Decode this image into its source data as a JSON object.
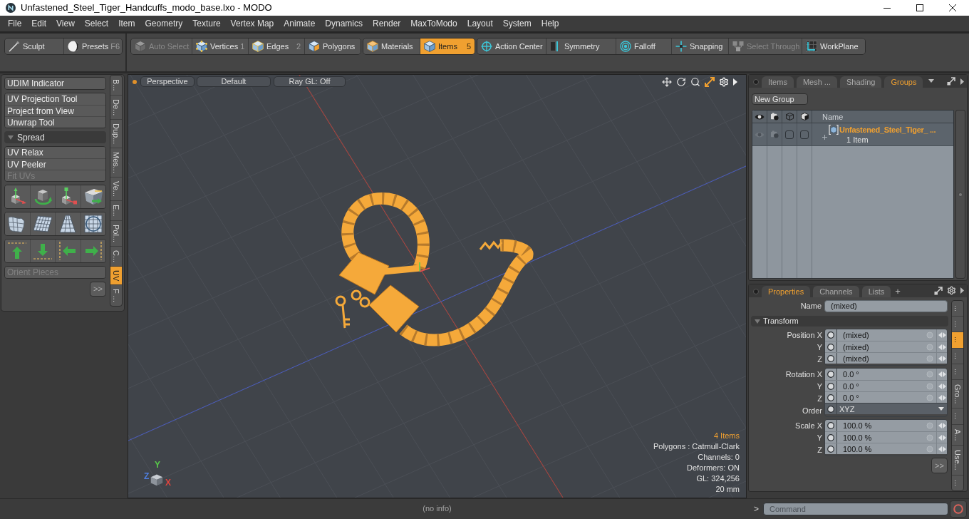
{
  "window": {
    "title": "Unfastened_Steel_Tiger_Handcuffs_modo_base.lxo - MODO"
  },
  "menu": [
    "File",
    "Edit",
    "View",
    "Select",
    "Item",
    "Geometry",
    "Texture",
    "Vertex Map",
    "Animate",
    "Dynamics",
    "Render",
    "MaxToModo",
    "Layout",
    "System",
    "Help"
  ],
  "toolbar": [
    {
      "tools": [
        {
          "label": "Sculpt",
          "selected": false,
          "disabled": false
        },
        {
          "label": "Presets",
          "shortcut": "F6",
          "selected": false,
          "disabled": false
        }
      ]
    },
    {
      "tools": [
        {
          "label": "Auto Select",
          "selected": false,
          "disabled": true
        },
        {
          "label": "Vertices",
          "shortcut": "1",
          "selected": false,
          "disabled": false
        },
        {
          "label": "Edges",
          "shortcut": "2",
          "selected": false,
          "disabled": false
        },
        {
          "label": "Polygons",
          "selected": false,
          "disabled": false
        }
      ]
    },
    {
      "tools": [
        {
          "label": "Materials",
          "selected": false,
          "disabled": false
        },
        {
          "label": "Items",
          "shortcut": "5",
          "selected": true,
          "disabled": false
        }
      ]
    },
    {
      "tools": [
        {
          "label": "Action Center",
          "selected": false,
          "disabled": false
        },
        {
          "label": "Symmetry",
          "selected": false,
          "disabled": false
        },
        {
          "label": "Falloff",
          "selected": false,
          "disabled": false
        },
        {
          "label": "Snapping",
          "selected": false,
          "disabled": false
        },
        {
          "label": "Select Through",
          "selected": false,
          "disabled": true
        },
        {
          "label": "WorkPlane",
          "selected": false,
          "disabled": false
        }
      ]
    }
  ],
  "tool_panel": {
    "groups": [
      {
        "kind": "buttons",
        "items": [
          {
            "label": "UDIM Indicator",
            "disabled": false
          }
        ]
      },
      {
        "kind": "buttons",
        "items": [
          {
            "label": "UV Projection Tool",
            "disabled": false
          },
          {
            "label": "Project from View",
            "disabled": false
          },
          {
            "label": "Unwrap Tool",
            "disabled": false
          }
        ]
      },
      {
        "kind": "section",
        "label": "Spread",
        "expanded": true
      },
      {
        "kind": "buttons",
        "items": [
          {
            "label": "UV Relax",
            "disabled": false
          },
          {
            "label": "UV Peeler",
            "disabled": false
          },
          {
            "label": "Fit UVs",
            "disabled": true
          }
        ]
      },
      {
        "kind": "icon_grid"
      },
      {
        "kind": "buttons",
        "items": [
          {
            "label": "Orient Pieces",
            "disabled": true
          }
        ]
      }
    ],
    "more_button": ">>",
    "side_tabs": [
      {
        "label": "B...",
        "selected": false
      },
      {
        "label": "De...",
        "selected": false
      },
      {
        "label": "Dup...",
        "selected": false
      },
      {
        "label": "Mes...",
        "selected": false
      },
      {
        "label": "Ve...",
        "selected": false
      },
      {
        "label": "E...",
        "selected": false
      },
      {
        "label": "Pol...",
        "selected": false
      },
      {
        "label": "C...",
        "selected": false
      },
      {
        "label": "UV",
        "selected": true
      },
      {
        "label": "F ...",
        "selected": false
      }
    ]
  },
  "viewport": {
    "view_buttons": [
      "Perspective",
      "Default",
      "Ray GL: Off"
    ],
    "info": [
      {
        "text": "4 Items",
        "highlight": true
      },
      {
        "text": "Polygons : Catmull-Clark",
        "highlight": false
      },
      {
        "text": "Channels: 0",
        "highlight": false
      },
      {
        "text": "Deformers: ON",
        "highlight": false
      },
      {
        "text": "GL: 324,256",
        "highlight": false
      },
      {
        "text": "20 mm",
        "highlight": false
      }
    ],
    "axes": [
      {
        "label": "Y",
        "color": "#58c84a"
      },
      {
        "label": "Z",
        "color": "#4f7fe0"
      },
      {
        "label": "X",
        "color": "#e0453f"
      }
    ]
  },
  "groups_panel": {
    "tabs": [
      {
        "label": "Items",
        "selected": false
      },
      {
        "label": "Mesh ...",
        "selected": false
      },
      {
        "label": "Shading",
        "selected": false
      },
      {
        "label": "Groups",
        "selected": true
      }
    ],
    "new_group": "New Group",
    "name_column": "Name",
    "rows": [
      {
        "name": "Unfastened_Steel_Tiger_ ...",
        "count": "1 Item",
        "expanded": false
      }
    ]
  },
  "properties_panel": {
    "tabs": [
      {
        "label": "Properties",
        "selected": true
      },
      {
        "label": "Channels",
        "selected": false
      },
      {
        "label": "Lists",
        "selected": false
      }
    ],
    "add_tab": "+",
    "name_field": {
      "label": "Name",
      "value": "(mixed)"
    },
    "section": {
      "label": "Transform",
      "expanded": true
    },
    "blocks": [
      {
        "rows": [
          {
            "kind": "value",
            "label": "Position X",
            "value": "(mixed)"
          },
          {
            "kind": "value",
            "label": "Y",
            "value": "(mixed)"
          },
          {
            "kind": "value",
            "label": "Z",
            "value": "(mixed)"
          }
        ]
      },
      {
        "rows": [
          {
            "kind": "value",
            "label": "Rotation X",
            "value": "0.0 °"
          },
          {
            "kind": "value",
            "label": "Y",
            "value": "0.0 °"
          },
          {
            "kind": "value",
            "label": "Z",
            "value": "0.0 °"
          },
          {
            "kind": "dropdown",
            "label": "Order",
            "value": "XYZ"
          }
        ]
      },
      {
        "rows": [
          {
            "kind": "value",
            "label": "Scale X",
            "value": "100.0 %"
          },
          {
            "kind": "value",
            "label": "Y",
            "value": "100.0 %"
          },
          {
            "kind": "value",
            "label": "Z",
            "value": "100.0 %"
          }
        ]
      }
    ],
    "more_button": ">>",
    "side_tabs": [
      {
        "label": "...",
        "selected": false
      },
      {
        "label": "...",
        "selected": false
      },
      {
        "label": "...",
        "selected": true
      },
      {
        "label": "...",
        "selected": false
      },
      {
        "label": "...",
        "selected": false
      },
      {
        "label": "Gro...",
        "selected": false
      },
      {
        "label": "...",
        "selected": false
      },
      {
        "label": "A...",
        "selected": false
      },
      {
        "label": "Use...",
        "selected": false
      },
      {
        "label": "...",
        "selected": false
      }
    ]
  },
  "status_bar": {
    "text": "(no info)"
  },
  "command": {
    "prompt": ">",
    "placeholder": "Command"
  }
}
